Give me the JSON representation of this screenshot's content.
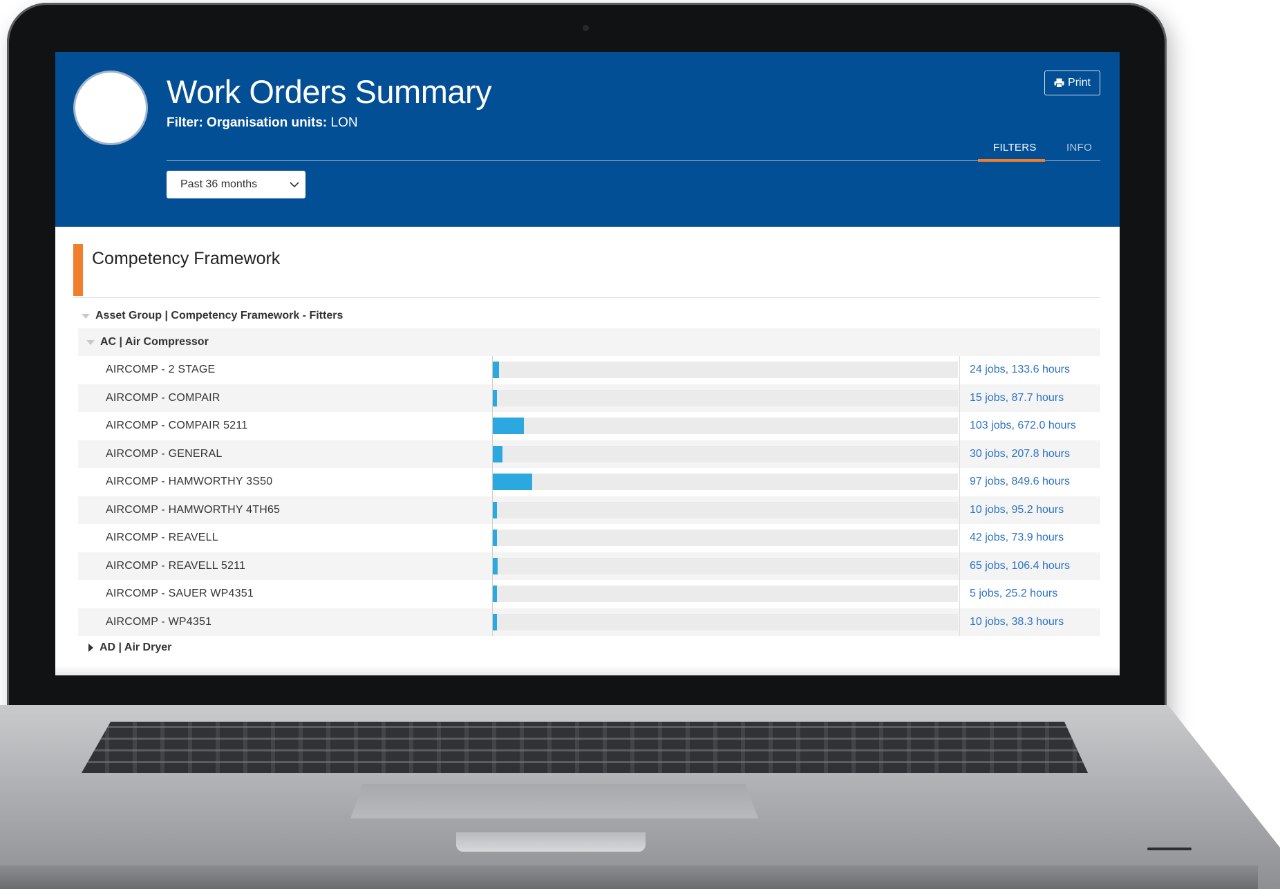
{
  "header": {
    "title": "Work Orders Summary",
    "filter_prefix": "Filter: Organisation units:",
    "filter_value": "LON",
    "print_label": "Print",
    "tabs": [
      {
        "label": "FILTERS",
        "active": true
      },
      {
        "label": "INFO",
        "active": false
      }
    ],
    "period_select": {
      "value": "Past 36 months"
    }
  },
  "colors": {
    "header_bg": "#034f95",
    "accent": "#f07e2b",
    "bar": "#2aa8df",
    "value_text": "#2b72c4"
  },
  "icons": [
    "print-icon",
    "chevron-down-icon",
    "caret-down-icon",
    "caret-right-icon"
  ],
  "section": {
    "title": "Competency Framework",
    "group_label": "Asset Group | Competency Framework - Fitters",
    "subgroup_label": "AC | Air Compressor",
    "collapsed_group_label": "AD | Air Dryer"
  },
  "chart_data": {
    "type": "bar",
    "orientation": "horizontal",
    "categories": [
      "AIRCOMP - 2 STAGE",
      "AIRCOMP - COMPAIR",
      "AIRCOMP - COMPAIR 5211",
      "AIRCOMP - GENERAL",
      "AIRCOMP - HAMWORTHY 3S50",
      "AIRCOMP - HAMWORTHY 4TH65",
      "AIRCOMP - REAVELL",
      "AIRCOMP - REAVELL 5211",
      "AIRCOMP - SAUER WP4351",
      "AIRCOMP - WP4351"
    ],
    "values": [
      133.6,
      87.7,
      672.0,
      207.8,
      849.6,
      95.2,
      73.9,
      106.4,
      25.2,
      38.3
    ],
    "jobs": [
      24,
      15,
      103,
      30,
      97,
      10,
      42,
      65,
      5,
      10
    ],
    "value_labels": [
      "24 jobs, 133.6 hours",
      "15 jobs, 87.7 hours",
      "103 jobs, 672.0 hours",
      "30 jobs, 207.8 hours",
      "97 jobs, 849.6 hours",
      "10 jobs, 95.2 hours",
      "42 jobs, 73.9 hours",
      "65 jobs, 106.4 hours",
      "5 jobs, 25.2 hours",
      "10 jobs, 38.3 hours"
    ],
    "xlim": [
      0,
      10000
    ]
  }
}
